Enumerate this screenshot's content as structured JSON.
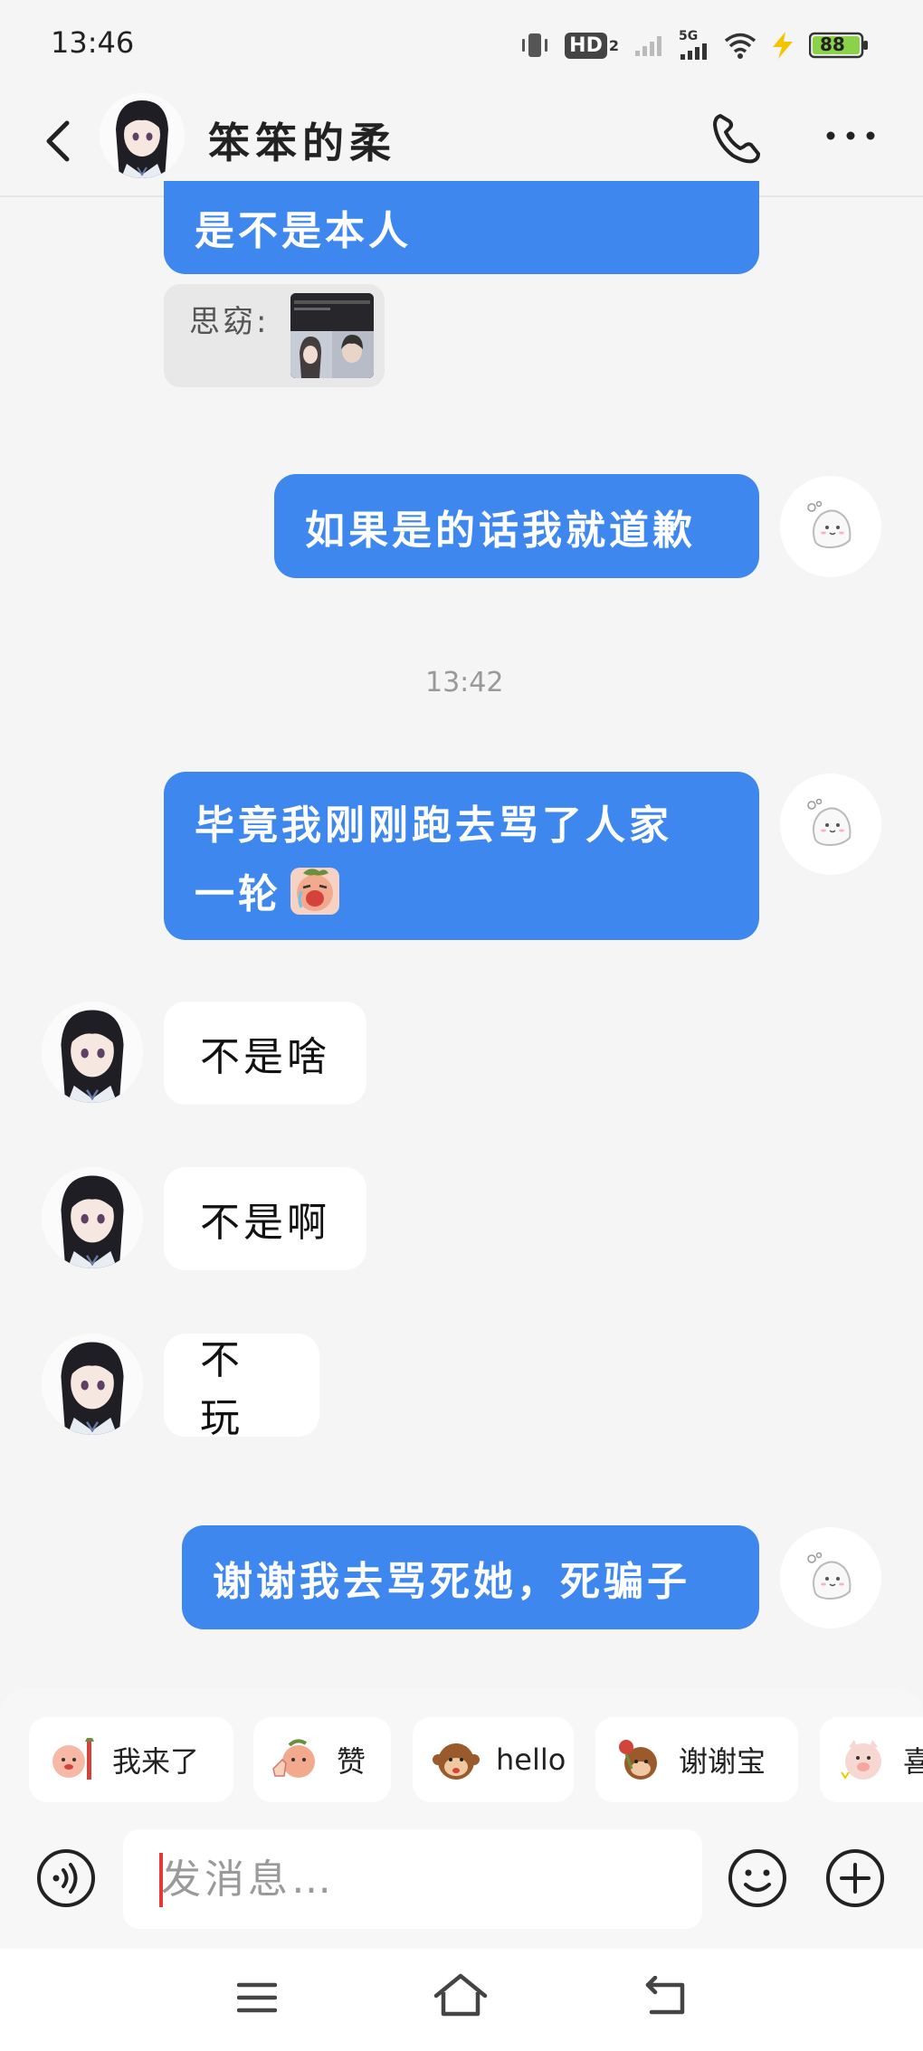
{
  "status_bar": {
    "time": "13:46",
    "icons": [
      "vibrate-icon",
      "hd-icon",
      "signal-icon",
      "5g-signal-icon",
      "wifi-icon",
      "charging-icon"
    ],
    "hd_label": "HD",
    "hd_sub": "2",
    "net_label": "5G",
    "battery": "88"
  },
  "header": {
    "contact_name": "笨笨的柔",
    "back_icon": "chevron-left-icon",
    "call_icon": "phone-icon",
    "more_icon": "more-dots-icon"
  },
  "messages": [
    {
      "side": "right",
      "text": "是不是本人",
      "partial": true
    },
    {
      "side": "left-quote",
      "prefix": "思窈:"
    },
    {
      "side": "right",
      "text": "如果是的话我就道歉"
    },
    {
      "timestamp": "13:42"
    },
    {
      "side": "right",
      "lines": [
        "毕竟我刚刚跑去骂了人家",
        "一轮"
      ]
    },
    {
      "side": "left",
      "text": "不是啥"
    },
    {
      "side": "left",
      "text": "不是啊"
    },
    {
      "side": "left",
      "text": "不玩"
    },
    {
      "side": "right",
      "text": "谢谢我去骂死她，死骗子"
    }
  ],
  "quick_stickers": [
    {
      "label": "我来了",
      "icon": "sticker-wave-icon"
    },
    {
      "label": "赞",
      "icon": "sticker-thumbs-icon"
    },
    {
      "label": "hello",
      "icon": "sticker-monkey-icon"
    },
    {
      "label": "谢谢宝",
      "icon": "sticker-rose-icon"
    },
    {
      "label": "喜",
      "icon": "sticker-pig-icon"
    }
  ],
  "input": {
    "placeholder": "发消息…",
    "voice_icon": "voice-icon",
    "emoji_icon": "smiley-icon",
    "plus_icon": "plus-circle-icon"
  },
  "nav": {
    "icons": [
      "menu-icon",
      "home-icon",
      "back-icon"
    ]
  },
  "colors": {
    "bubble_blue": "#3d87ee",
    "background": "#f5f5f5",
    "bubble_white": "#ffffff"
  }
}
